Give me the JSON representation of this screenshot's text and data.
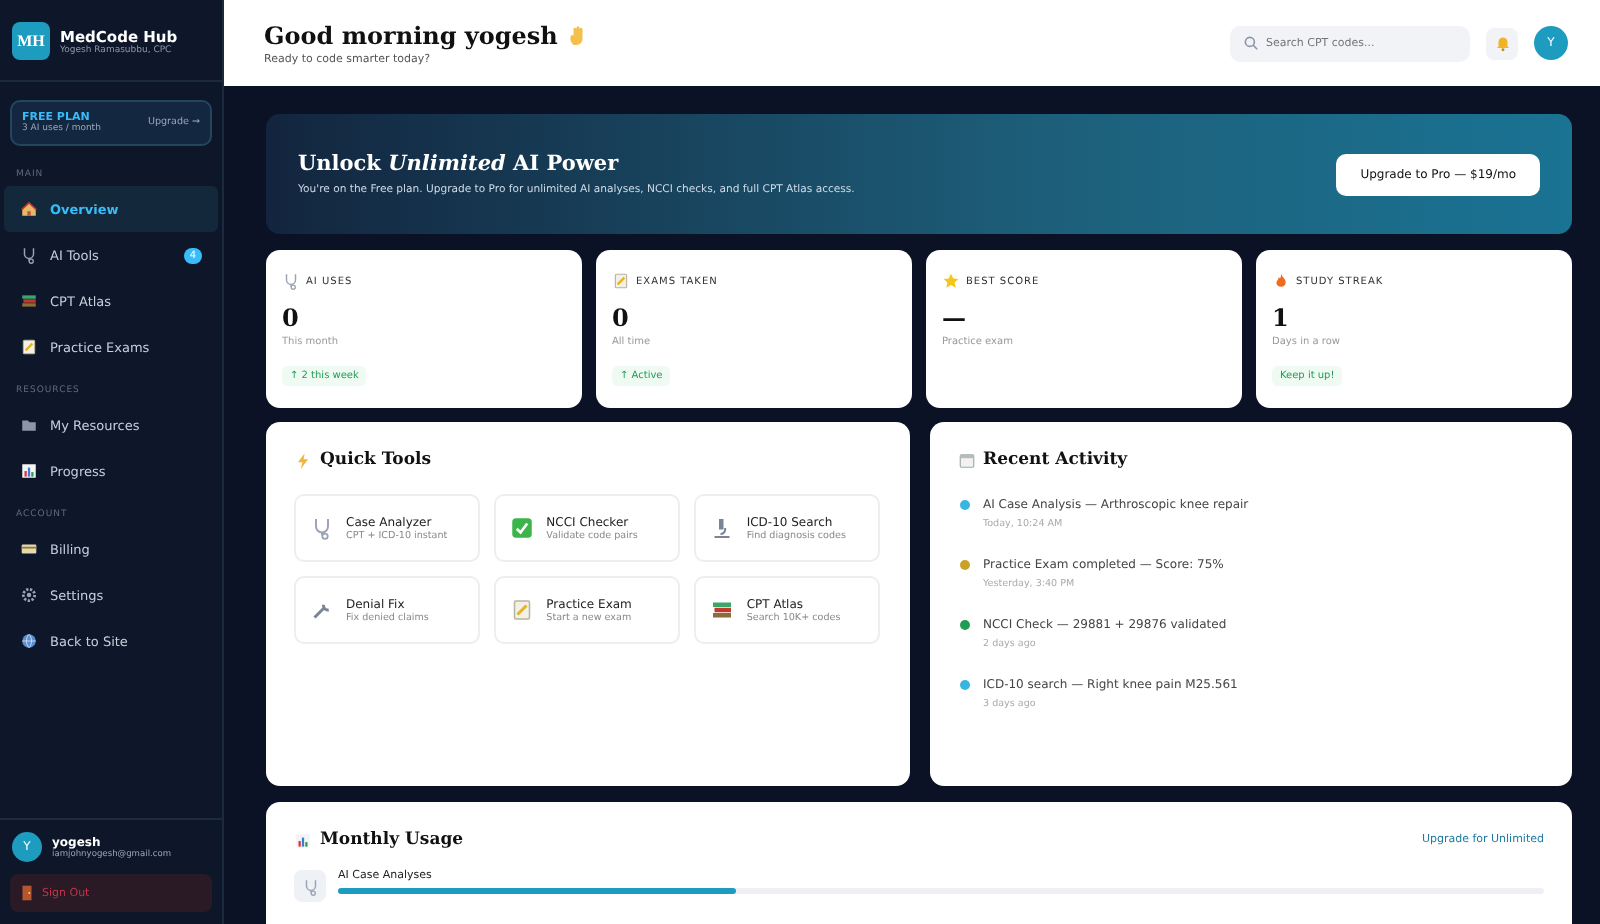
{
  "brand": {
    "logo": "MH",
    "name": "MedCode Hub",
    "subtitle": "Yogesh Ramasubbu, CPC"
  },
  "plan": {
    "title": "FREE PLAN",
    "detail": "3 AI uses / month",
    "link": "Upgrade →"
  },
  "nav": [
    {
      "section": "MAIN",
      "items": [
        {
          "label": "Overview",
          "selected": true
        },
        {
          "label": "AI Tools",
          "selected": false,
          "badge": "4"
        },
        {
          "label": "CPT Atlas",
          "selected": false
        },
        {
          "label": "Practice Exams",
          "selected": false
        }
      ]
    },
    {
      "section": "RESOURCES",
      "items": [
        {
          "label": "My Resources",
          "selected": false
        },
        {
          "label": "Progress",
          "selected": false
        }
      ]
    },
    {
      "section": "ACCOUNT",
      "items": [
        {
          "label": "Billing",
          "selected": false
        },
        {
          "label": "Settings",
          "selected": false
        },
        {
          "label": "Back to Site",
          "selected": false
        }
      ]
    }
  ],
  "user": {
    "initial": "Y",
    "name": "yogesh",
    "email": "iamjohnyogesh@gmail.com"
  },
  "sign_out": "Sign Out",
  "header": {
    "greeting": "Good morning yogesh",
    "subtitle": "Ready to code smarter today?",
    "search_placeholder": "Search CPT codes...",
    "avatar": "Y"
  },
  "banner": {
    "title": "Unlock *Unlimited* AI Power",
    "text": "You're on the Free plan. Upgrade to Pro for unlimited AI analyses, NCCI checks, and full CPT Atlas access.",
    "button": "Upgrade to Pro — $19/mo"
  },
  "stats": [
    {
      "label": "AI USES",
      "value": "0",
      "caption": "This month",
      "badge": "↑ 2 this week"
    },
    {
      "label": "EXAMS TAKEN",
      "value": "0",
      "caption": "All time",
      "badge": "↑ Active"
    },
    {
      "label": "BEST SCORE",
      "value": "—",
      "caption": "Practice exam"
    },
    {
      "label": "STUDY STREAK",
      "value": "1",
      "caption": "Days in a row",
      "badge": "Keep it up!"
    }
  ],
  "quick_tools": {
    "title": "Quick Tools",
    "tools": [
      {
        "name": "Case Analyzer",
        "desc": "CPT + ICD-10 instant"
      },
      {
        "name": "NCCI Checker",
        "desc": "Validate code pairs"
      },
      {
        "name": "ICD-10 Search",
        "desc": "Find diagnosis codes"
      },
      {
        "name": "Denial Fix",
        "desc": "Fix denied claims"
      },
      {
        "name": "Practice Exam",
        "desc": "Start a new exam"
      },
      {
        "name": "CPT Atlas",
        "desc": "Search 10K+ codes"
      }
    ]
  },
  "recent_activity": {
    "title": "Recent Activity",
    "items": [
      {
        "text": "AI Case Analysis — Arthroscopic knee repair",
        "time": "Today, 10:24 AM",
        "color": "#38b6e0"
      },
      {
        "text": "Practice Exam completed — Score: 75%",
        "time": "Yesterday, 3:40 PM",
        "color": "#c9a227"
      },
      {
        "text": "NCCI Check — 29881 + 29876 validated",
        "time": "2 days ago",
        "color": "#1f9d55"
      },
      {
        "text": "ICD-10 search — Right knee pain M25.561",
        "time": "3 days ago",
        "color": "#38b6e0"
      }
    ]
  },
  "monthly_usage": {
    "title": "Monthly Usage",
    "link": "Upgrade for Unlimited",
    "items": [
      {
        "label": "AI Case Analyses",
        "level": 0.33
      }
    ]
  }
}
